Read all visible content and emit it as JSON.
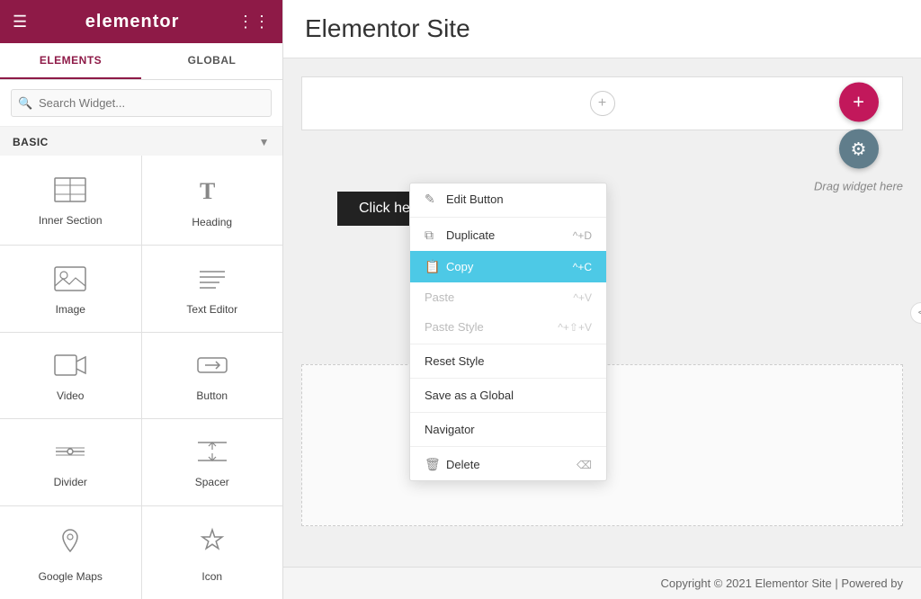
{
  "sidebar": {
    "logo": "elementor",
    "tabs": [
      {
        "label": "ELEMENTS",
        "active": true
      },
      {
        "label": "GLOBAL",
        "active": false
      }
    ],
    "search": {
      "placeholder": "Search Widget..."
    },
    "section_label": "BASIC",
    "widgets": [
      {
        "id": "inner-section",
        "label": "Inner Section",
        "icon": "inner-section-icon"
      },
      {
        "id": "heading",
        "label": "Heading",
        "icon": "heading-icon"
      },
      {
        "id": "image",
        "label": "Image",
        "icon": "image-icon"
      },
      {
        "id": "text-editor",
        "label": "Text Editor",
        "icon": "text-editor-icon"
      },
      {
        "id": "video",
        "label": "Video",
        "icon": "video-icon"
      },
      {
        "id": "button",
        "label": "Button",
        "icon": "button-icon"
      },
      {
        "id": "divider",
        "label": "Divider",
        "icon": "divider-icon"
      },
      {
        "id": "spacer",
        "label": "Spacer",
        "icon": "spacer-icon"
      },
      {
        "id": "google-maps",
        "label": "Google Maps",
        "icon": "google-maps-icon"
      },
      {
        "id": "icon",
        "label": "Icon",
        "icon": "icon-icon"
      }
    ]
  },
  "main": {
    "title": "Elementor Site",
    "canvas": {
      "add_section_plus": "+",
      "click_here_label": "Click here"
    },
    "context_menu": {
      "items": [
        {
          "label": "Edit Button",
          "icon": "edit-icon",
          "shortcut": "",
          "active": false,
          "muted": false
        },
        {
          "label": "Duplicate",
          "icon": "duplicate-icon",
          "shortcut": "^+D",
          "active": false,
          "muted": false
        },
        {
          "label": "Copy",
          "icon": "copy-icon",
          "shortcut": "^+C",
          "active": true,
          "muted": false
        },
        {
          "label": "Paste",
          "icon": "",
          "shortcut": "^+V",
          "active": false,
          "muted": true
        },
        {
          "label": "Paste Style",
          "icon": "",
          "shortcut": "^+⇧+V",
          "active": false,
          "muted": true
        },
        {
          "label": "Reset Style",
          "icon": "",
          "shortcut": "",
          "active": false,
          "muted": false
        },
        {
          "label": "Save as a Global",
          "icon": "",
          "shortcut": "",
          "active": false,
          "muted": false
        },
        {
          "label": "Navigator",
          "icon": "",
          "shortcut": "",
          "active": false,
          "muted": false
        },
        {
          "label": "Delete",
          "icon": "delete-icon",
          "shortcut": "⌫",
          "active": false,
          "muted": false
        }
      ]
    },
    "drag_area": {
      "add_label": "+",
      "settings_label": "⚙",
      "drag_text": "Drag widget here"
    },
    "footer": "Copyright © 2021 Elementor Site | Powered by"
  }
}
